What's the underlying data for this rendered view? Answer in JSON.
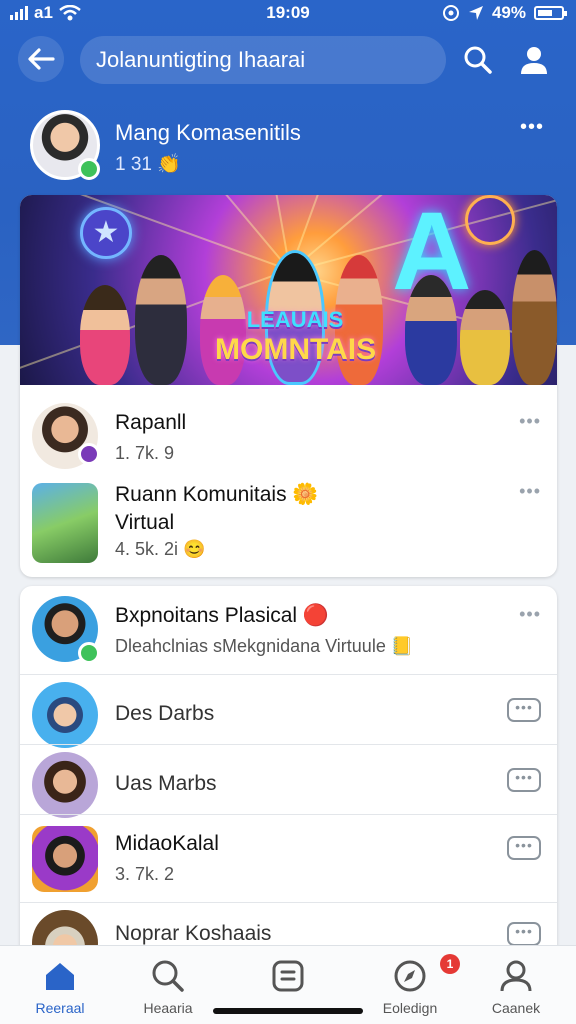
{
  "status_bar": {
    "carrier": "a1",
    "time": "19:09",
    "battery": "49%"
  },
  "header": {
    "search_text": "Jolanuntigting Ihaarai"
  },
  "community": {
    "name": "Mang Komasenitils",
    "sub": "1 31 👏"
  },
  "banner": {
    "title_line1": "LEAUAIS",
    "title_line2": "MOMNTAIS"
  },
  "card1_items": [
    {
      "name": "Rapanll",
      "sub": "1. 7k. 9"
    },
    {
      "name": "Ruann Komunitais 🌼",
      "name2": "Virtual",
      "sub": "4. 5k. 2i 😊"
    }
  ],
  "card2_items": [
    {
      "name": "Bxpnoitans Plasical 🔴",
      "sub": "Dleahclnias sMekgnidana Virtuule 📒"
    },
    {
      "name": "Des Darbs"
    },
    {
      "name": "Uas Marbs"
    },
    {
      "name": "MidaoKalal",
      "sub": "3. 7k. 2"
    },
    {
      "name": "Noprar Koshaais"
    }
  ],
  "bottom_nav": [
    {
      "label": "Reeraal",
      "icon": "home-icon",
      "active": true
    },
    {
      "label": "Heaaria",
      "icon": "search-icon"
    },
    {
      "label": "",
      "icon": "chat-icon"
    },
    {
      "label": "Eoledign",
      "icon": "compass-icon",
      "badge": "1"
    },
    {
      "label": "Caanek",
      "icon": "profile-icon"
    }
  ],
  "colors": {
    "primary": "#2a64c8",
    "online": "#3ec25a",
    "notification": "#e53935"
  }
}
